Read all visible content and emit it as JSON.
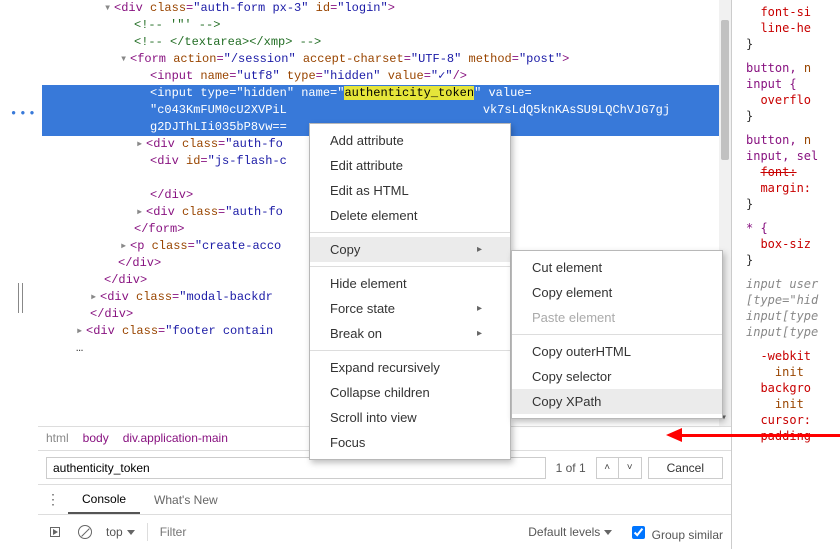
{
  "dom": {
    "line1": "<div class=\"auth-form px-3\" id=\"login\">",
    "line2": "<!-- '\"' -->",
    "line3": "<!-- </textarea></xmp> -->",
    "line4": "<form action=\"/session\" accept-charset=\"UTF-8\" method=\"post\">",
    "line5": "<input name=\"utf8\" type=\"hidden\" value=\"✓\"/>",
    "line6a": "<input type=\"hidden\" name=\"",
    "line6b": "authenticity_token",
    "line6c": "\" value=",
    "line7": "\"c043KmFUM0cU2XVPiL____________________vk7sLdQ5knKAsSU9LQChVJG7gjg2DJThLIi035bP8vw==\">",
    "line8": "<div class=\"auth-fo",
    "line9": "<div id=\"js-flash-c",
    "line10": "</div>",
    "line11": "<div class=\"auth-fo",
    "line12": "</form>",
    "line13": "<p class=\"create-acco",
    "line14": "</div>",
    "line15": "</div>",
    "line16": "<div class=\"modal-backdr",
    "line17": "</div>",
    "line18": "<div class=\"footer contain",
    "line19": "…"
  },
  "breadcrumb": {
    "p1": "html",
    "p2": "body",
    "p3": "div.application-main"
  },
  "search": {
    "value": "authenticity_token",
    "count": "1 of 1",
    "cancel": "Cancel"
  },
  "drawerTabs": {
    "console": "Console",
    "whatsnew": "What's New"
  },
  "console": {
    "top": "top",
    "topArrow": "▾",
    "levels": "Default levels",
    "filter_ph": "Filter",
    "group": "Group similar"
  },
  "ctx1": {
    "addAttr": "Add attribute",
    "editAttr": "Edit attribute",
    "editHtml": "Edit as HTML",
    "delete": "Delete element",
    "copy": "Copy",
    "hide": "Hide element",
    "force": "Force state",
    "break": "Break on",
    "expand": "Expand recursively",
    "collapse": "Collapse children",
    "scroll": "Scroll into view",
    "focus": "Focus"
  },
  "ctx2": {
    "cut": "Cut element",
    "copyEl": "Copy element",
    "paste": "Paste element",
    "outer": "Copy outerHTML",
    "selector": "Copy selector",
    "xpath": "Copy XPath"
  },
  "styles": {
    "s1_p1": "font-si",
    "s1_p2": "line-he",
    "s2_sel": "button,",
    "s2_sel2": "input {",
    "s2_p1": "overflo",
    "s3_sel": "button,",
    "s3_sel2": "input, sel",
    "s3_p1": "font:",
    "s3_p2": "margin:",
    "s4_sel": "* {",
    "s4_p1": "box-siz",
    "s5_sel1": "input  user",
    "s5_sel2": "[type=\"hid",
    "s5_sel3": "input[type",
    "s5_sel4": "input[type",
    "s6_p1": "-webkit",
    "s6_p2": "init",
    "s6_p3": "backgro",
    "s6_p4": "init",
    "s6_p5": "cursor:",
    "s6_p6": "padding"
  }
}
